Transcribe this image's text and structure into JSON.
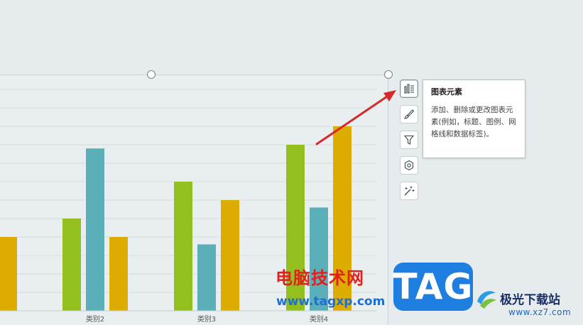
{
  "chart_data": {
    "type": "bar",
    "categories": [
      "类别2",
      "类别3",
      "类别4"
    ],
    "series": [
      {
        "color": "#93c01f",
        "values": [
          2.5,
          3.5,
          4.5
        ]
      },
      {
        "color": "#5aafb9",
        "values": [
          4.4,
          1.8,
          2.8
        ]
      },
      {
        "color": "#dcad00",
        "values": [
          2.0,
          3.0,
          5.0
        ]
      }
    ],
    "partial_series3_before_category2": 2.0,
    "ylim": [
      0,
      6
    ],
    "grid": true
  },
  "toolbar": {
    "buttons": [
      {
        "name": "chart-elements-button",
        "icon": "bar-chart-list-icon",
        "active": true
      },
      {
        "name": "chart-styles-button",
        "icon": "brush-icon",
        "active": false
      },
      {
        "name": "chart-filter-button",
        "icon": "funnel-icon",
        "active": false
      },
      {
        "name": "chart-settings-button",
        "icon": "hexagon-settings-icon",
        "active": false
      },
      {
        "name": "quick-layout-button",
        "icon": "magic-wand-icon",
        "active": false
      }
    ]
  },
  "tooltip": {
    "title": "图表元素",
    "description": "添加、删除或更改图表元素(例如，标题、图例、网格线和数据标签)。"
  },
  "watermark": {
    "cn_text": "电脑技术网",
    "url": "www.tagxp.com",
    "tag": "TAG",
    "site_name": "极光下载站",
    "site_url": "www.xz7.com"
  },
  "colors": {
    "arrow": "#d42a2a",
    "accent_blue": "#1f7fe0"
  }
}
